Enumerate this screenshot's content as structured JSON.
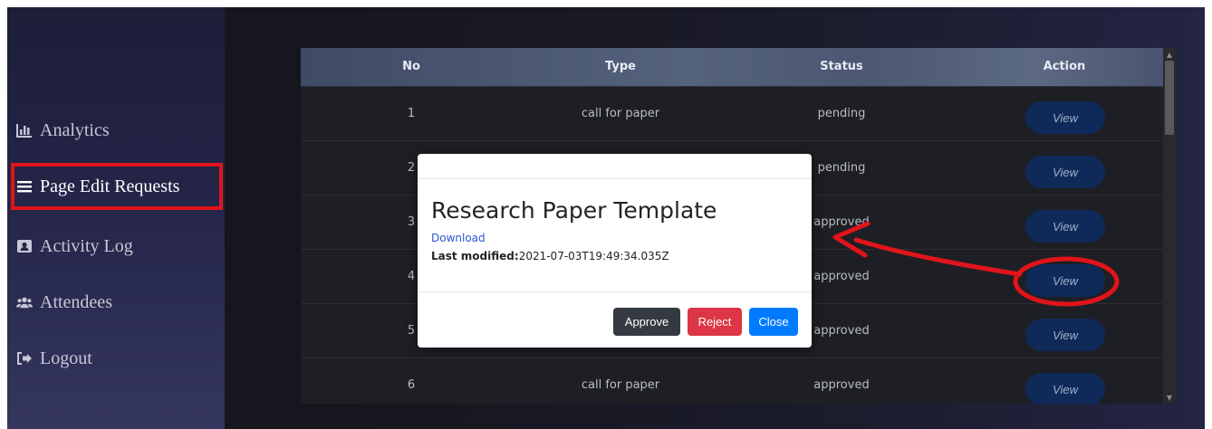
{
  "sidebar": {
    "items": [
      {
        "label": "Analytics",
        "icon": "bar-chart-icon"
      },
      {
        "label": "Page Edit Requests",
        "icon": "list-icon"
      },
      {
        "label": "Activity Log",
        "icon": "id-card-icon"
      },
      {
        "label": "Attendees",
        "icon": "users-icon"
      },
      {
        "label": "Logout",
        "icon": "logout-icon"
      }
    ],
    "selected": "Page Edit Requests"
  },
  "table": {
    "headers": [
      "No",
      "Type",
      "Status",
      "Action"
    ],
    "rows": [
      {
        "no": "1",
        "type": "call for paper",
        "status": "pending",
        "action": "View"
      },
      {
        "no": "2",
        "type": "",
        "status": "pending",
        "action": "View"
      },
      {
        "no": "3",
        "type": "",
        "status": "approved",
        "action": "View"
      },
      {
        "no": "4",
        "type": "",
        "status": "approved",
        "action": "View"
      },
      {
        "no": "5",
        "type": "",
        "status": "approved",
        "action": "View"
      },
      {
        "no": "6",
        "type": "call for paper",
        "status": "approved",
        "action": "View"
      }
    ]
  },
  "modal": {
    "title": "Research Paper Template",
    "download_label": "Download",
    "last_modified_label": "Last modified:",
    "last_modified_value": "2021-07-03T19:49:34.035Z",
    "buttons": {
      "approve": "Approve",
      "reject": "Reject",
      "close": "Close"
    }
  },
  "colors": {
    "annotation": "#e0141a",
    "approve": "#343a40",
    "reject": "#dc3545",
    "close": "#007bff",
    "view_button": "#0f2a58"
  }
}
